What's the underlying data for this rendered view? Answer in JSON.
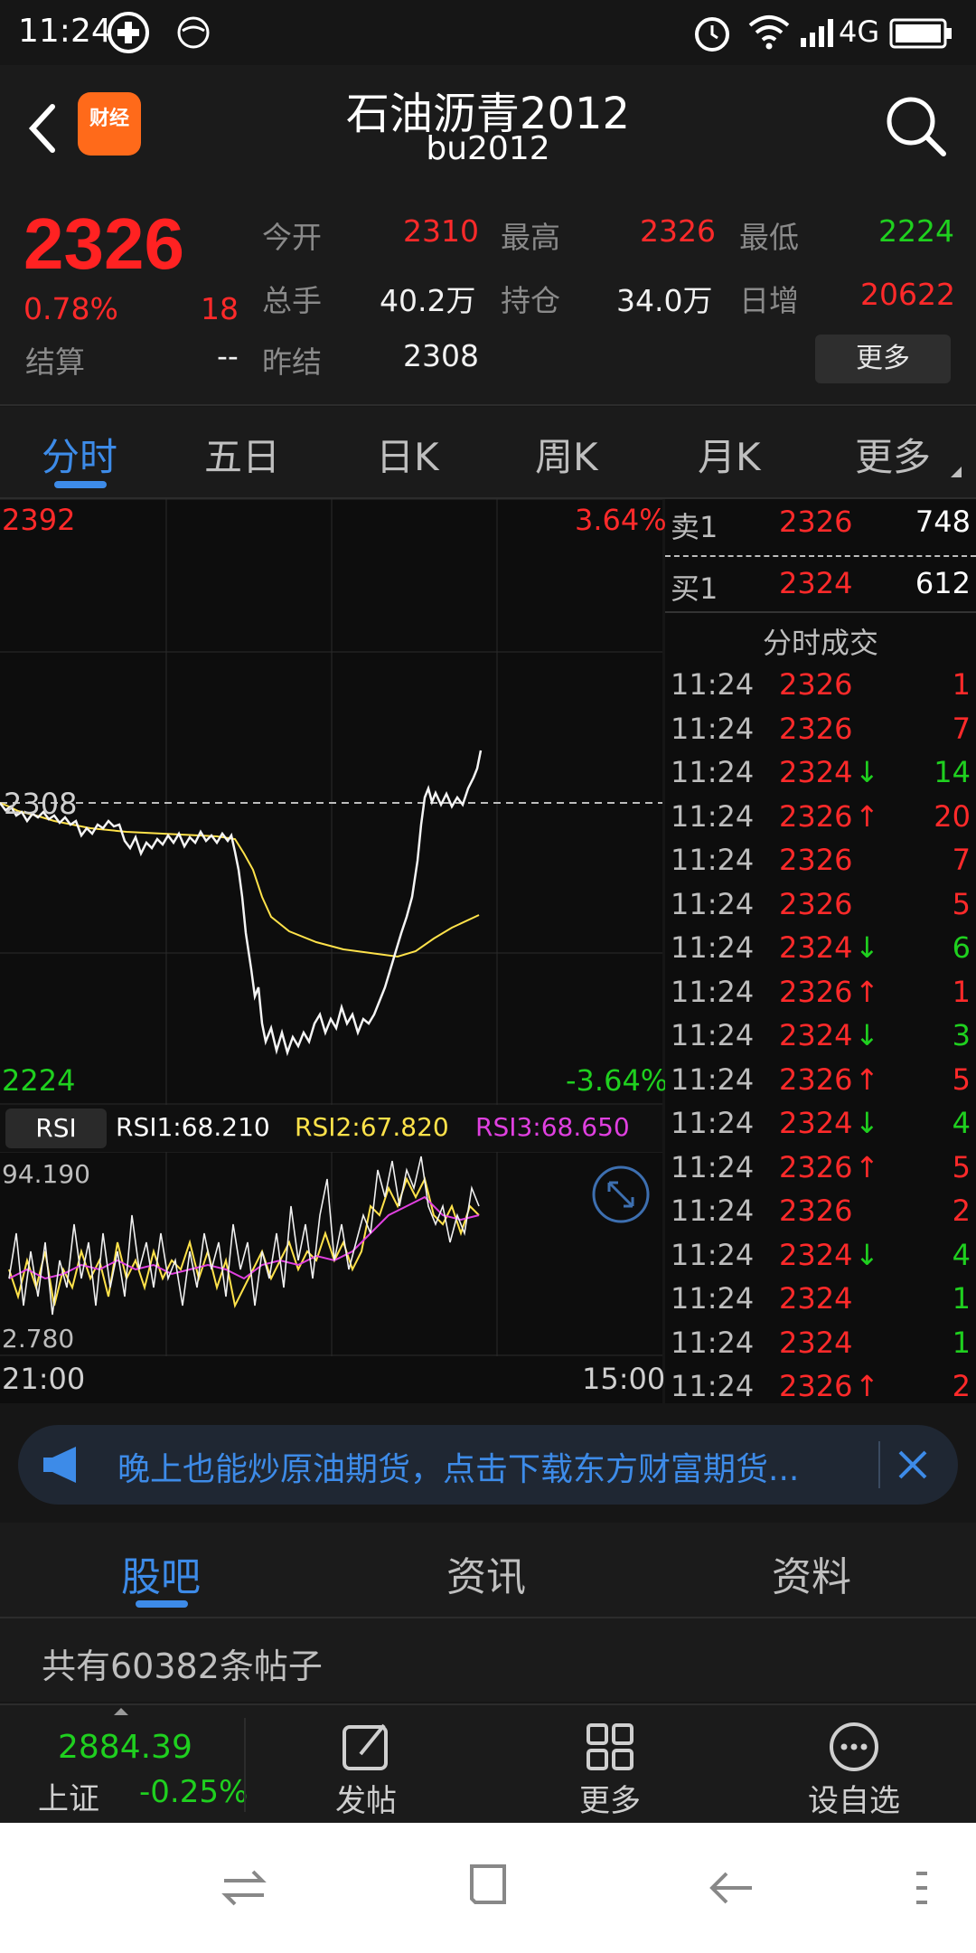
{
  "status": {
    "time": "11:24",
    "network": "4G"
  },
  "header": {
    "title": "石油沥青2012",
    "subtitle": "bu2012",
    "logo_text": "财经"
  },
  "quote": {
    "price": "2326",
    "change_pct": "0.78%",
    "change": "18",
    "settle_label": "结算",
    "settle_value": "--",
    "open_label": "今开",
    "open_value": "2310",
    "high_label": "最高",
    "high_value": "2326",
    "low_label": "最低",
    "low_value": "2224",
    "volume_label": "总手",
    "volume_value": "40.2万",
    "oi_label": "持仓",
    "oi_value": "34.0万",
    "daily_inc_label": "日增",
    "daily_inc_value": "20622",
    "prev_settle_label": "昨结",
    "prev_settle_value": "2308",
    "more_label": "更多"
  },
  "tabs": [
    "分时",
    "五日",
    "日K",
    "周K",
    "月K",
    "更多"
  ],
  "chart": {
    "y_top": "2392",
    "y_top_pct": "3.64%",
    "y_mid": "2308",
    "y_bottom": "2224",
    "y_bottom_pct": "-3.64%",
    "time_start": "21:00",
    "time_end": "15:00"
  },
  "rsi": {
    "button": "RSI",
    "rsi1": "RSI1:68.210",
    "rsi2": "RSI2:67.820",
    "rsi3": "RSI3:68.650",
    "max": "94.190",
    "min": "2.780"
  },
  "orderbook": {
    "sell_label": "卖1",
    "sell_price": "2326",
    "sell_vol": "748",
    "buy_label": "买1",
    "buy_price": "2324",
    "buy_vol": "612",
    "trades_title": "分时成交",
    "trades": [
      {
        "time": "11:24",
        "price": "2326",
        "vol": "1",
        "dir": "",
        "vc": "red"
      },
      {
        "time": "11:24",
        "price": "2326",
        "vol": "7",
        "dir": "",
        "vc": "red"
      },
      {
        "time": "11:24",
        "price": "2324",
        "vol": "14",
        "dir": "↓",
        "vc": "green"
      },
      {
        "time": "11:24",
        "price": "2326",
        "vol": "20",
        "dir": "↑",
        "vc": "red"
      },
      {
        "time": "11:24",
        "price": "2326",
        "vol": "7",
        "dir": "",
        "vc": "red"
      },
      {
        "time": "11:24",
        "price": "2326",
        "vol": "5",
        "dir": "",
        "vc": "red"
      },
      {
        "time": "11:24",
        "price": "2324",
        "vol": "6",
        "dir": "↓",
        "vc": "green"
      },
      {
        "time": "11:24",
        "price": "2326",
        "vol": "1",
        "dir": "↑",
        "vc": "red"
      },
      {
        "time": "11:24",
        "price": "2324",
        "vol": "3",
        "dir": "↓",
        "vc": "green"
      },
      {
        "time": "11:24",
        "price": "2326",
        "vol": "5",
        "dir": "↑",
        "vc": "red"
      },
      {
        "time": "11:24",
        "price": "2324",
        "vol": "4",
        "dir": "↓",
        "vc": "green"
      },
      {
        "time": "11:24",
        "price": "2326",
        "vol": "5",
        "dir": "↑",
        "vc": "red"
      },
      {
        "time": "11:24",
        "price": "2326",
        "vol": "2",
        "dir": "",
        "vc": "red"
      },
      {
        "time": "11:24",
        "price": "2324",
        "vol": "4",
        "dir": "↓",
        "vc": "green"
      },
      {
        "time": "11:24",
        "price": "2324",
        "vol": "1",
        "dir": "",
        "vc": "green"
      },
      {
        "time": "11:24",
        "price": "2324",
        "vol": "1",
        "dir": "",
        "vc": "green"
      },
      {
        "time": "11:24",
        "price": "2326",
        "vol": "2",
        "dir": "↑",
        "vc": "red"
      }
    ]
  },
  "banner": {
    "text": "晚上也能炒原油期货，点击下载东方财富期货..."
  },
  "bottom_tabs": [
    "股吧",
    "资讯",
    "资料"
  ],
  "posts": {
    "text": "共有60382条帖子"
  },
  "footer": {
    "index_value": "2884.39",
    "index_name": "上证",
    "index_change": "-0.25%",
    "post_label": "发帖",
    "more_label": "更多",
    "watch_label": "设自选"
  },
  "colors": {
    "up": "#ff2a2a",
    "down": "#1fd01f",
    "accent": "#3d8be8",
    "rsi2": "#ffe24a",
    "rsi3": "#e040e0"
  }
}
